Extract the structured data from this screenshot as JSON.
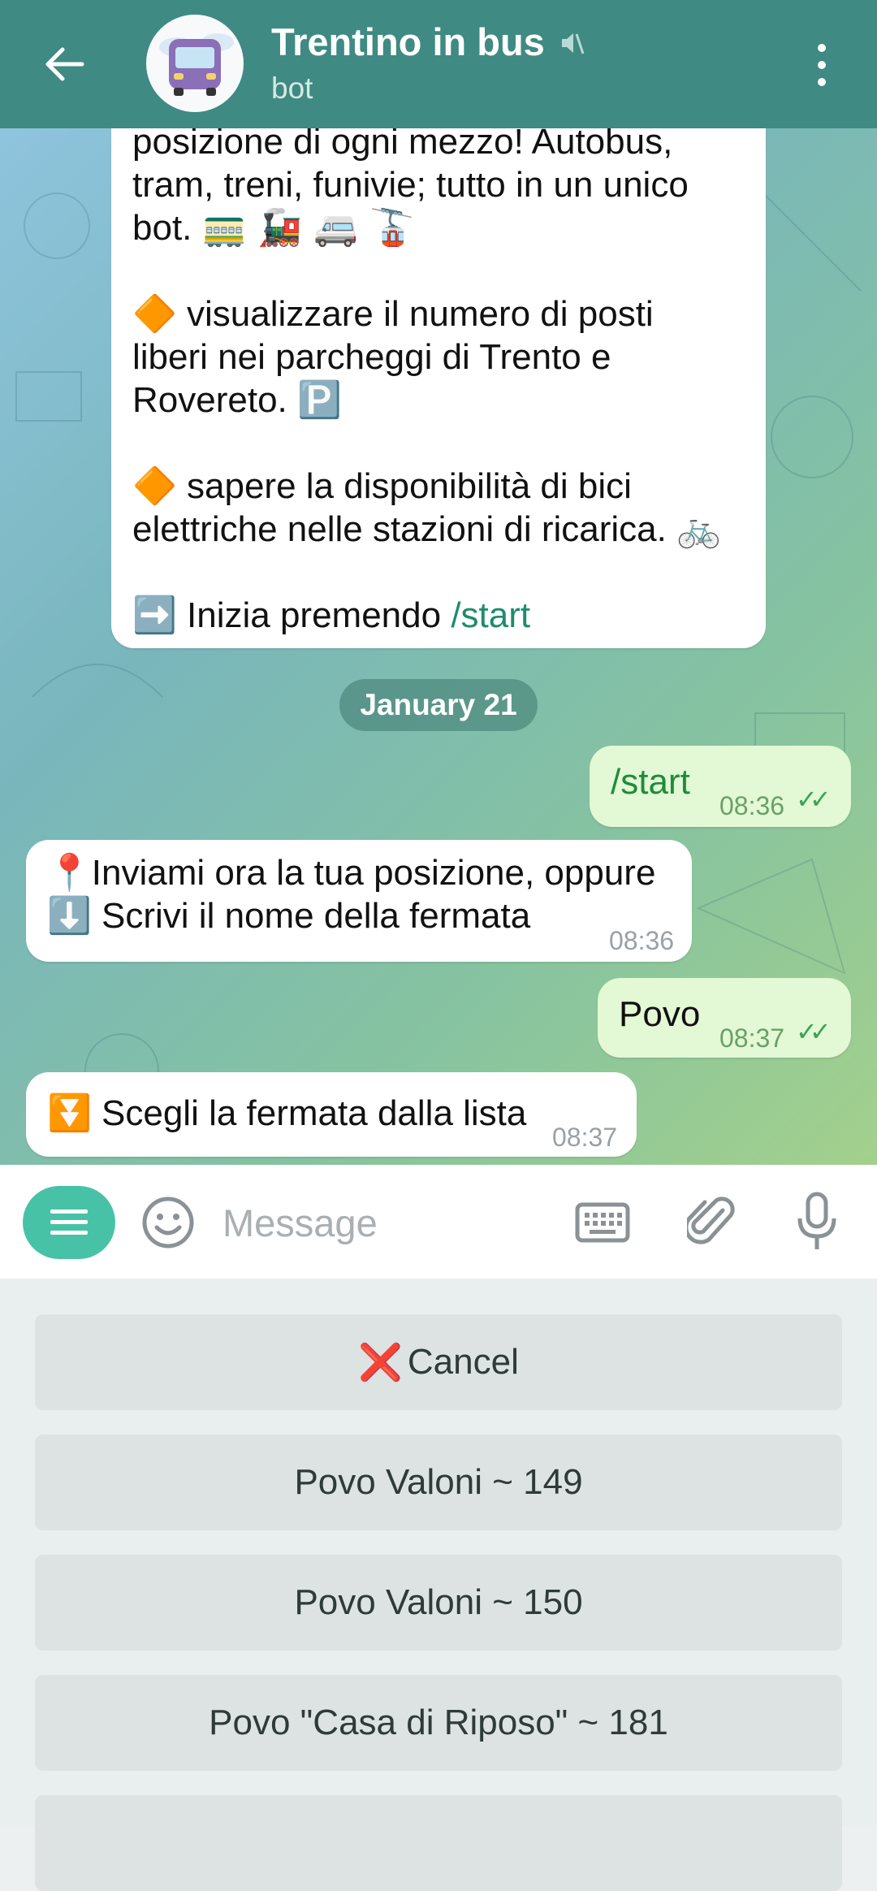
{
  "header": {
    "title": "Trentino in bus",
    "subtitle": "bot",
    "avatar_caption": "Trentino in Bus"
  },
  "messages": {
    "intro": {
      "line1": "posizione di ogni mezzo! Autobus,",
      "line2": "tram, treni, funivie; tutto in un unico",
      "line3_text": "bot. ",
      "line3_emoji": "🚃 🚂 🚐 🚡",
      "b2_bullet": "🔶",
      "b2_l1": " visualizzare il numero di posti",
      "b2_l2": "liberi nei parcheggi di Trento e",
      "b2_l3": "Rovereto. ",
      "b2_emoji": "🅿️",
      "b3_bullet": "🔶",
      "b3_l1": " sapere la disponibilità di bici",
      "b3_l2": "elettriche nelle stazioni di ricarica. ",
      "b3_emoji": "🚲",
      "cta_emoji": "➡️",
      "cta_text": " Inizia premendo ",
      "cta_link": "/start"
    },
    "date_separator": "January 21",
    "out1": {
      "text": "/start",
      "time": "08:36",
      "check": "✓✓"
    },
    "in1": {
      "l1_emoji": "📍",
      "l1_text": "Inviami ora la tua posizione, oppure",
      "l2_emoji": "⬇️",
      "l2_text": " Scrivi il nome della fermata",
      "time": "08:36"
    },
    "out2": {
      "text": "Povo",
      "time": "08:37",
      "check": "✓✓"
    },
    "in2": {
      "emoji": "⏬",
      "text": " Scegli la fermata dalla lista",
      "time": "08:37"
    }
  },
  "input": {
    "placeholder": "Message"
  },
  "keyboard": {
    "cancel_icon": "❌",
    "cancel_label": "Cancel",
    "options": [
      "Povo Valoni ~ 149",
      "Povo Valoni ~ 150",
      "Povo \"Casa di Riposo\" ~ 181"
    ]
  },
  "colors": {
    "header": "#3f8a82",
    "accent": "#48c2a6",
    "outgoing_bubble": "#e3f8d4",
    "link": "#1e8c6e"
  },
  "icons": [
    "back-arrow-icon",
    "mute-icon",
    "more-vert-icon",
    "menu-icon",
    "emoji-icon",
    "keyboard-icon",
    "attach-icon",
    "mic-icon"
  ]
}
